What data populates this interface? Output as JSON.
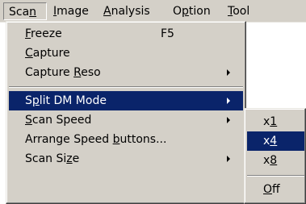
{
  "menubar": {
    "items": [
      {
        "label": "Scan",
        "mnemonic": "n"
      },
      {
        "label": "Image",
        "mnemonic": "I"
      },
      {
        "label": "Analysis",
        "mnemonic": "A"
      },
      {
        "label": "Option",
        "mnemonic": "p"
      },
      {
        "label": "Tool",
        "mnemonic": "T"
      }
    ]
  },
  "scan_menu": {
    "items": [
      {
        "pre": "",
        "u": "F",
        "post": "reeze",
        "shortcut": "F5"
      },
      {
        "pre": "",
        "u": "C",
        "post": "apture"
      },
      {
        "pre": "Capture ",
        "u": "R",
        "post": "eso",
        "submenu": true
      },
      {
        "pre": "S",
        "u": "p",
        "post": "lit DM Mode",
        "submenu": true,
        "selected": true
      },
      {
        "pre": "",
        "u": "S",
        "post": "can Speed",
        "submenu": true
      },
      {
        "pre": "Arrange Speed ",
        "u": "b",
        "post": "uttons...",
        "submenu": false
      },
      {
        "pre": "Scan Si",
        "u": "z",
        "post": "e",
        "submenu": true
      }
    ]
  },
  "split_submenu": {
    "items": [
      {
        "pre": "x",
        "u": "1",
        "post": ""
      },
      {
        "pre": "x",
        "u": "4",
        "post": "",
        "selected": true
      },
      {
        "pre": "x",
        "u": "8",
        "post": ""
      },
      {
        "pre": "",
        "u": "O",
        "post": "ff"
      }
    ]
  },
  "colors": {
    "menu_face": "#d4d0c8",
    "highlight": "#0a246a",
    "highlight_text": "#ffffff"
  }
}
